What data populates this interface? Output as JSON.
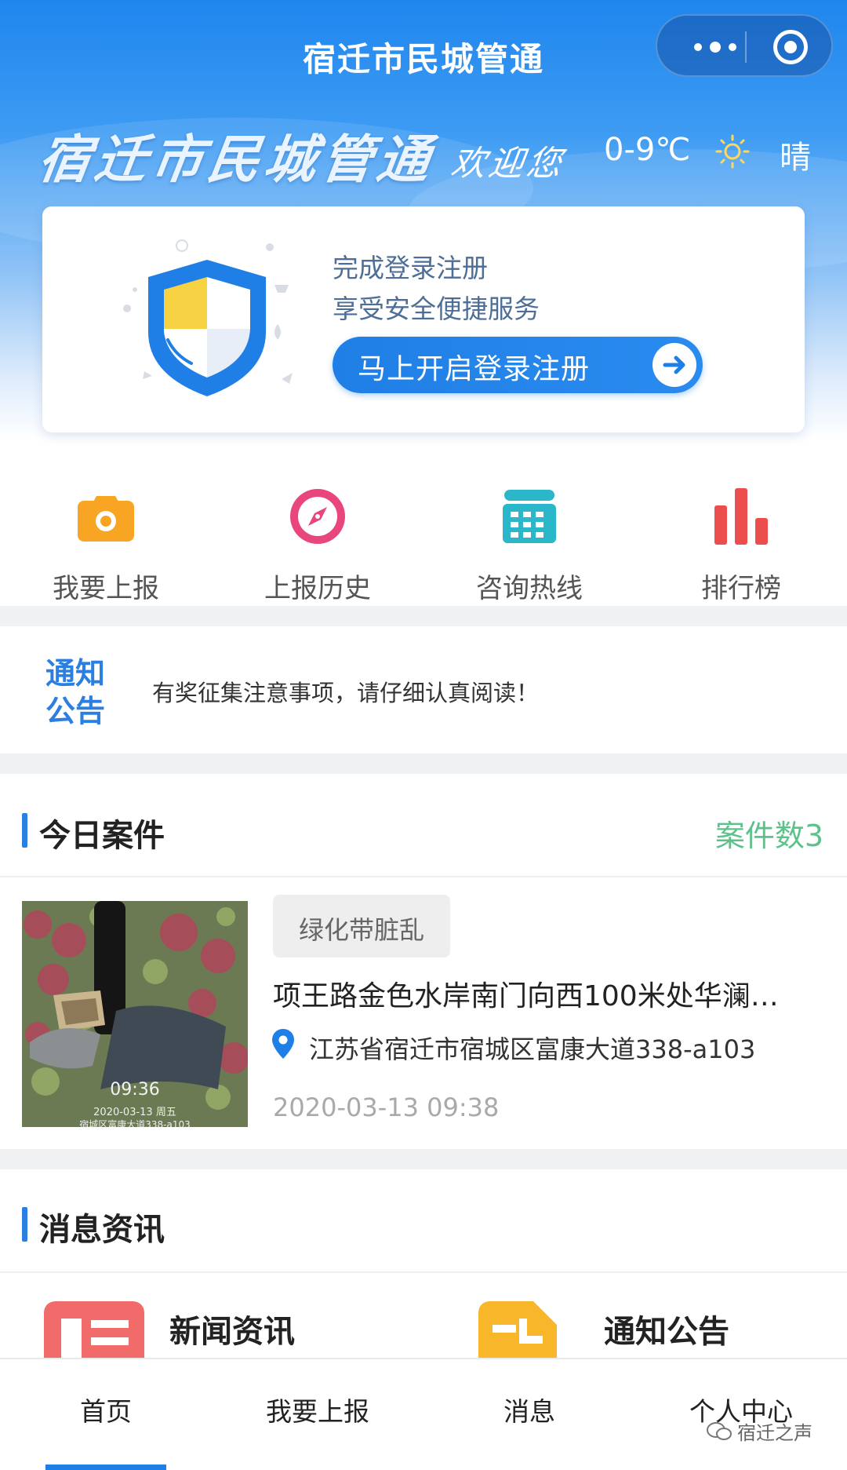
{
  "nav": {
    "title": "宿迁市民城管通"
  },
  "banner": {
    "slogan": "宿迁市民城管通",
    "welcome": "欢迎您",
    "temperature": "0-9℃",
    "weather_icon": "sun-icon",
    "weather": "晴"
  },
  "login": {
    "line1": "完成登录注册",
    "line2": "享受安全便捷服务",
    "button_label": "马上开启登录注册"
  },
  "menu": [
    {
      "label": "我要上报",
      "icon": "camera-icon",
      "color": "#f8a523"
    },
    {
      "label": "上报历史",
      "icon": "compass-icon",
      "color": "#e8467d"
    },
    {
      "label": "咨询热线",
      "icon": "telephone-icon",
      "color": "#2ab7c9"
    },
    {
      "label": "排行榜",
      "icon": "bar-chart-icon",
      "color": "#ec4d4d"
    }
  ],
  "notice": {
    "tag": "通知公告",
    "text": "有奖征集注意事项，请仔细认真阅读！"
  },
  "today_cases": {
    "title": "今日案件",
    "count_label": "案件数3",
    "items": [
      {
        "category": "绿化带脏乱",
        "title": "项王路金色水岸南门向西100米处华澜…",
        "address": "江苏省宿迁市宿城区富康大道338-a103",
        "time": "2020-03-13 09:38",
        "photo": {
          "time": "09:36",
          "date": "2020-03-13 周五",
          "address": "宿城区富康大道338-a103"
        }
      }
    ]
  },
  "news": {
    "title": "消息资讯",
    "items": [
      {
        "label": "新闻资讯",
        "icon": "newspaper-icon",
        "color": "#f26b6b"
      },
      {
        "label": "通知公告",
        "icon": "document-icon",
        "color": "#f8b62a"
      }
    ]
  },
  "tabbar": {
    "items": [
      "首页",
      "我要上报",
      "消息",
      "个人中心"
    ],
    "active_index": 0
  },
  "watermark": "宿迁之声",
  "colors": {
    "primary": "#1f7fe6",
    "green": "#5bc38a",
    "header_top": "#1f86ee"
  }
}
